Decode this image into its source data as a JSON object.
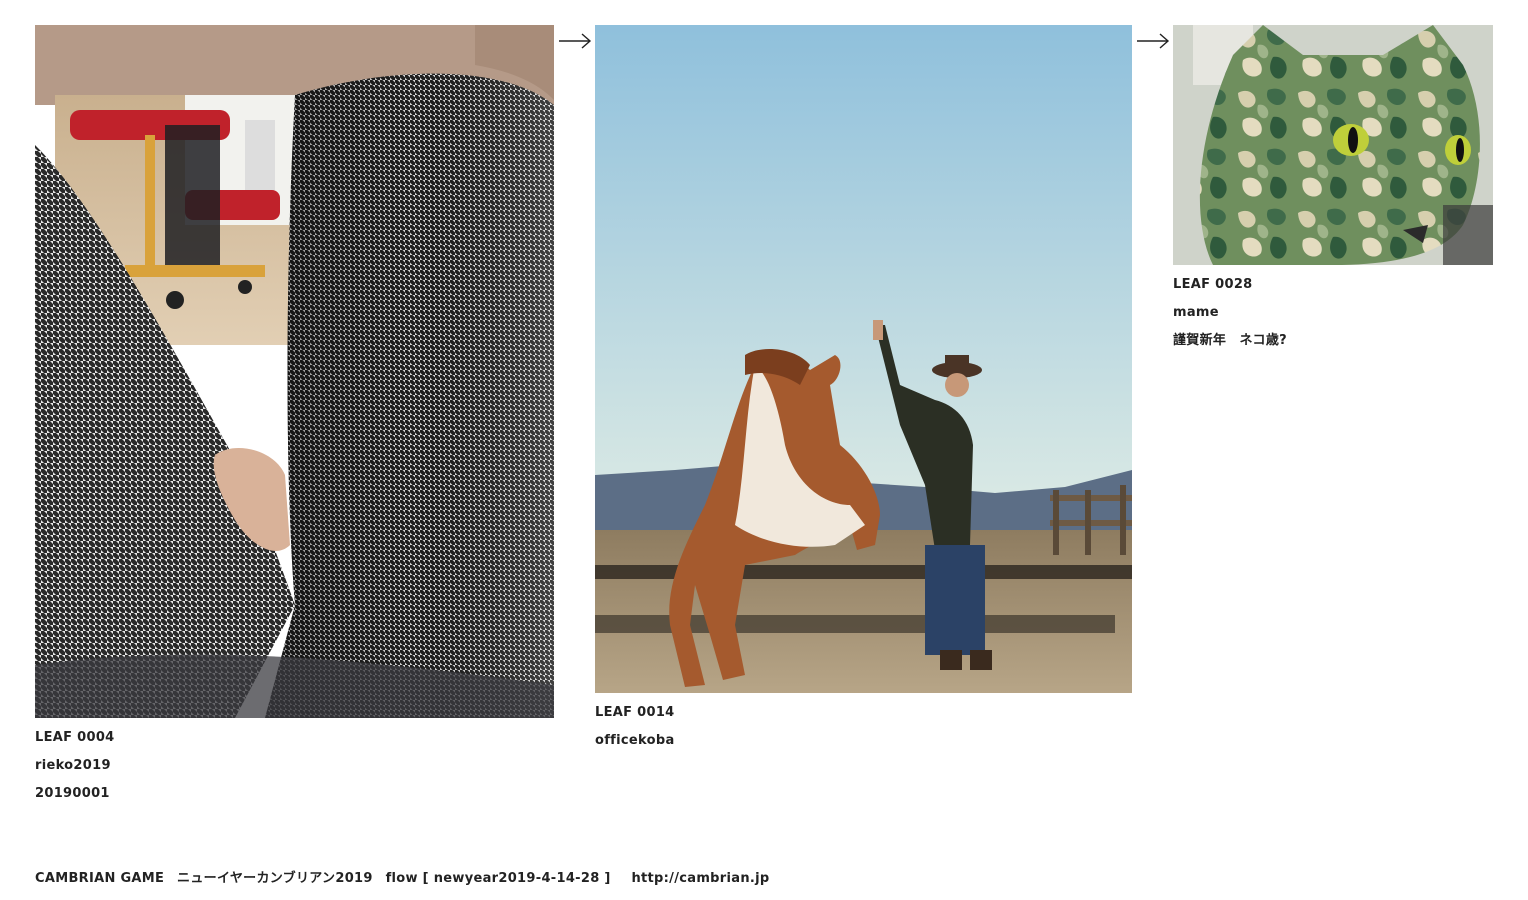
{
  "leaves": [
    {
      "id": "LEAF 0004",
      "author": "rieko2019",
      "note": "20190001"
    },
    {
      "id": "LEAF 0014",
      "author": "officekoba"
    },
    {
      "id": "LEAF 0028",
      "author": "mame",
      "note": "謹賀新年　ネコ歳?"
    }
  ],
  "footer": {
    "brand": "CAMBRIAN GAME",
    "title": "ニューイヤーカンブリアン2019",
    "flow": "flow [ newyear2019-4-14-28 ]",
    "url": "http://cambrian.jp"
  },
  "colors": {
    "text": "#222222",
    "background": "#ffffff",
    "arrow": "#222222"
  },
  "icons": {
    "arrow": "right-arrow-icon"
  }
}
